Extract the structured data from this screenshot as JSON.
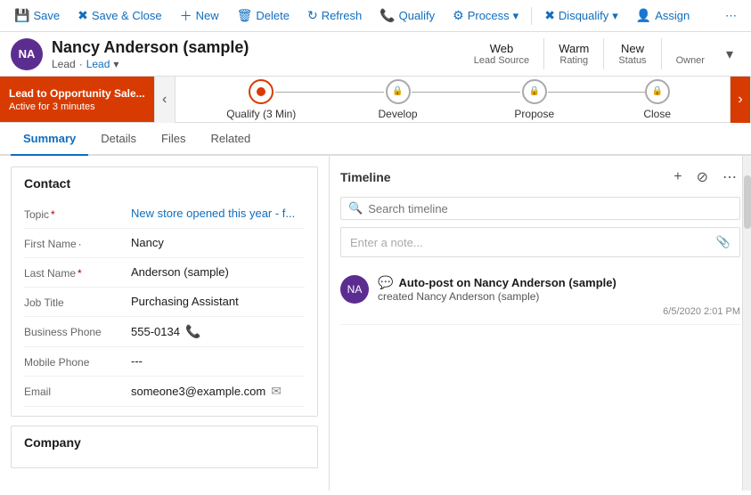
{
  "toolbar": {
    "save_label": "Save",
    "save_close_label": "Save & Close",
    "new_label": "New",
    "delete_label": "Delete",
    "refresh_label": "Refresh",
    "qualify_label": "Qualify",
    "process_label": "Process",
    "disqualify_label": "Disqualify",
    "assign_label": "Assign",
    "more_icon": "⋯"
  },
  "header": {
    "avatar_initials": "NA",
    "name": "Nancy Anderson (sample)",
    "record_type": "Lead",
    "record_subtype": "Lead",
    "meta": [
      {
        "label": "Lead Source",
        "value": "Web"
      },
      {
        "label": "Rating",
        "value": "Warm"
      },
      {
        "label": "Status",
        "value": "New"
      },
      {
        "label": "Owner",
        "value": ""
      }
    ],
    "chevron_icon": "▾"
  },
  "process_bar": {
    "promo_title": "Lead to Opportunity Sale...",
    "promo_sub": "Active for 3 minutes",
    "nav_left_icon": "‹",
    "nav_right_icon": "›",
    "stages": [
      {
        "id": "qualify",
        "label": "Qualify (3 Min)",
        "active": true,
        "locked": false
      },
      {
        "id": "develop",
        "label": "Develop",
        "active": false,
        "locked": true
      },
      {
        "id": "propose",
        "label": "Propose",
        "active": false,
        "locked": true
      },
      {
        "id": "close",
        "label": "Close",
        "active": false,
        "locked": true
      }
    ]
  },
  "nav_tabs": [
    {
      "id": "summary",
      "label": "Summary",
      "active": true
    },
    {
      "id": "details",
      "label": "Details",
      "active": false
    },
    {
      "id": "files",
      "label": "Files",
      "active": false
    },
    {
      "id": "related",
      "label": "Related",
      "active": false
    }
  ],
  "contact_section": {
    "title": "Contact",
    "fields": [
      {
        "id": "topic",
        "label": "Topic",
        "required": true,
        "value": "New store opened this year - f...",
        "icon": ""
      },
      {
        "id": "first_name",
        "label": "First Name",
        "required": true,
        "value": "Nancy",
        "icon": ""
      },
      {
        "id": "last_name",
        "label": "Last Name",
        "required": true,
        "value": "Anderson (sample)",
        "icon": ""
      },
      {
        "id": "job_title",
        "label": "Job Title",
        "required": false,
        "value": "Purchasing Assistant",
        "icon": ""
      },
      {
        "id": "business_phone",
        "label": "Business Phone",
        "required": false,
        "value": "555-0134",
        "icon": "📞"
      },
      {
        "id": "mobile_phone",
        "label": "Mobile Phone",
        "required": false,
        "value": "---",
        "icon": ""
      },
      {
        "id": "email",
        "label": "Email",
        "required": false,
        "value": "someone3@example.com",
        "icon": "✉"
      }
    ]
  },
  "company_section": {
    "title": "Company"
  },
  "timeline": {
    "title": "Timeline",
    "add_icon": "+",
    "filter_icon": "⊘",
    "more_icon": "⋯",
    "search_placeholder": "Search timeline",
    "note_placeholder": "Enter a note...",
    "attachment_icon": "📎",
    "items": [
      {
        "id": "autopost-1",
        "avatar_initials": "NA",
        "post_icon": "💬",
        "title": "Auto-post on Nancy Anderson (sample)",
        "sub": "created Nancy Anderson (sample)",
        "timestamp": "6/5/2020 2:01 PM"
      }
    ]
  }
}
